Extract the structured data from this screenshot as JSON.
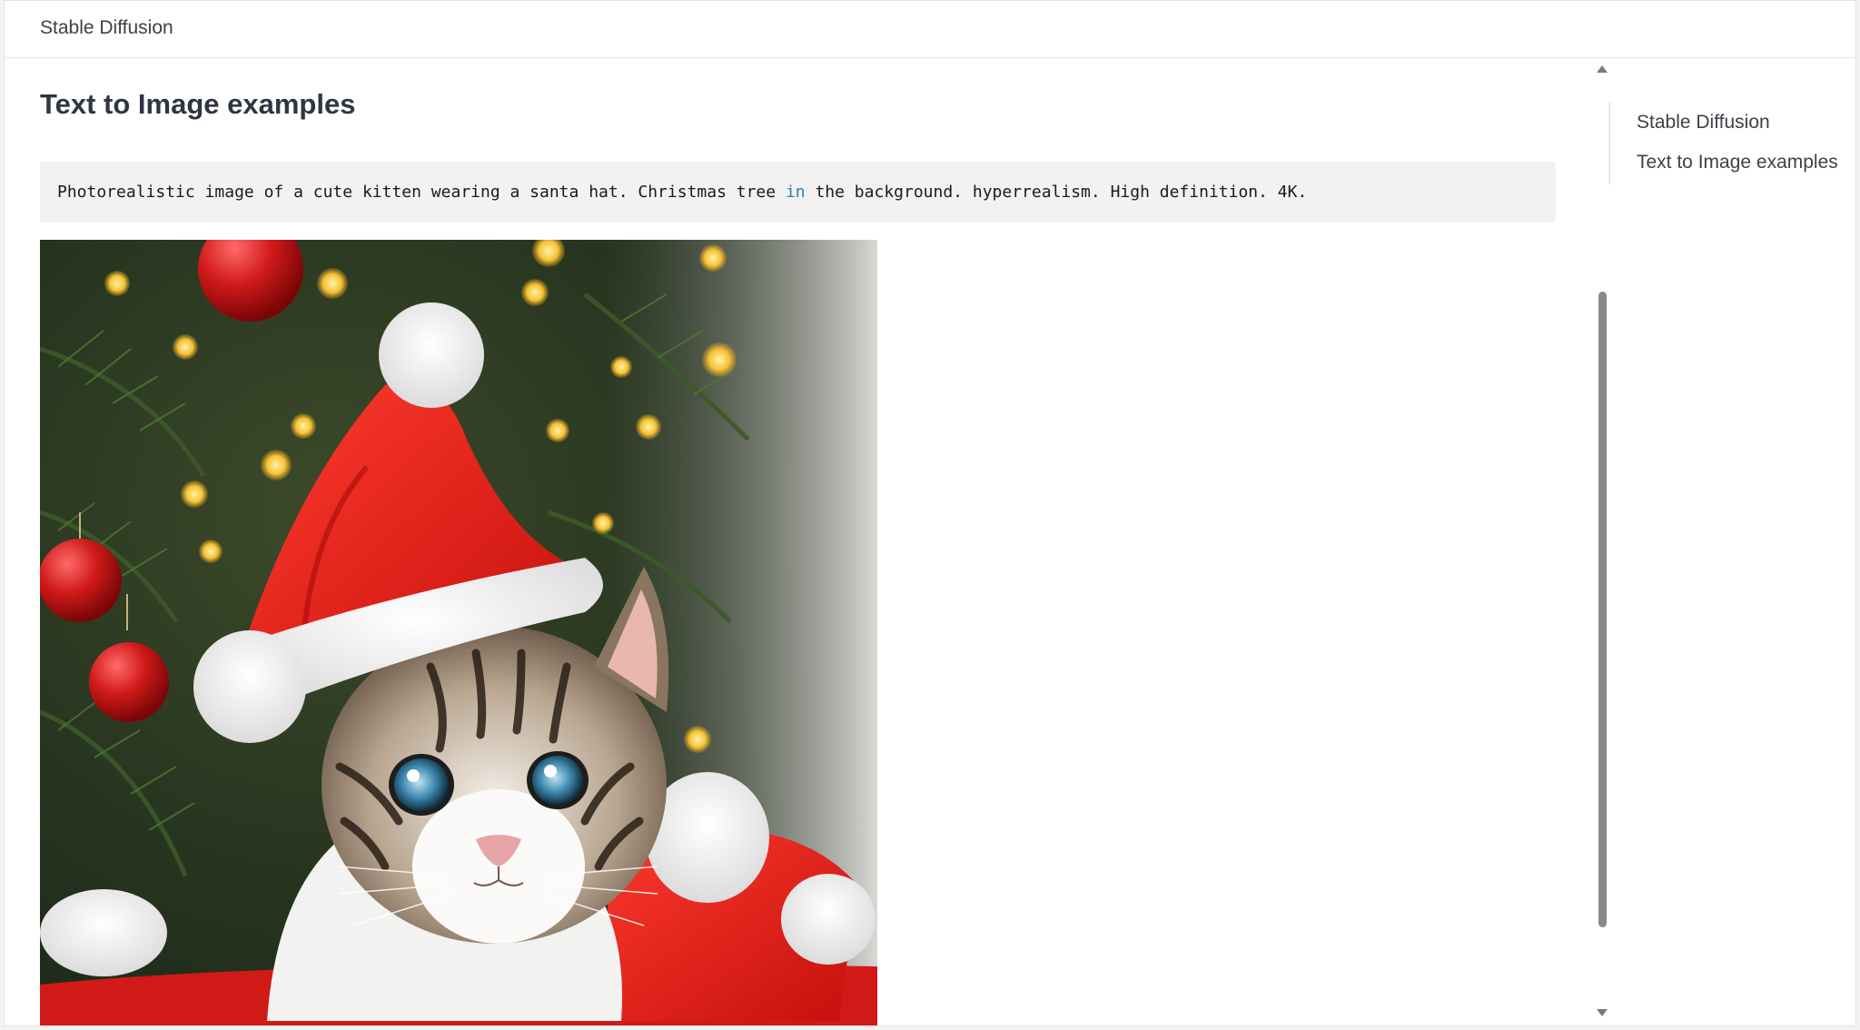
{
  "header": {
    "title": "Stable Diffusion"
  },
  "main": {
    "heading": "Text to Image examples",
    "code": {
      "before": "Photorealistic image of a cute kitten wearing a santa hat. Christmas tree ",
      "keyword": "in",
      "after": " the background. hyperrealism. High definition. 4K."
    },
    "image": {
      "alt": "kitten-in-santa-hat"
    }
  },
  "toc": {
    "items": [
      {
        "label": "Stable Diffusion"
      },
      {
        "label": "Text to Image examples"
      }
    ]
  },
  "colors": {
    "accent_keyword": "#2b7fb5",
    "code_background": "#f4f2f0",
    "scrollbar_thumb": "#8a8a8a"
  }
}
